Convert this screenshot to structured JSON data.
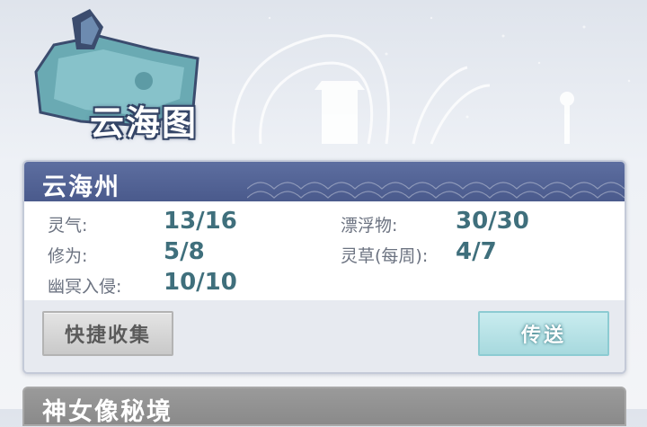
{
  "title": "云海图",
  "region_card": {
    "name": "云海州",
    "stats": [
      {
        "label": "灵气:",
        "value": "13/16"
      },
      {
        "label": "漂浮物:",
        "value": "30/30"
      },
      {
        "label": "修为:",
        "value": "5/8"
      },
      {
        "label": "灵草(每周):",
        "value": "4/7"
      },
      {
        "label": "幽冥入侵:",
        "value": "10/10"
      }
    ],
    "quick_collect_label": "快捷收集",
    "teleport_label": "传送"
  },
  "next_card": {
    "name": "神女像秘境"
  },
  "colors": {
    "header_bg": "#4a5a8c",
    "value_text": "#3f6f7c",
    "teleport_button": "#a7d9de",
    "quick_button": "#c9c9c9"
  }
}
